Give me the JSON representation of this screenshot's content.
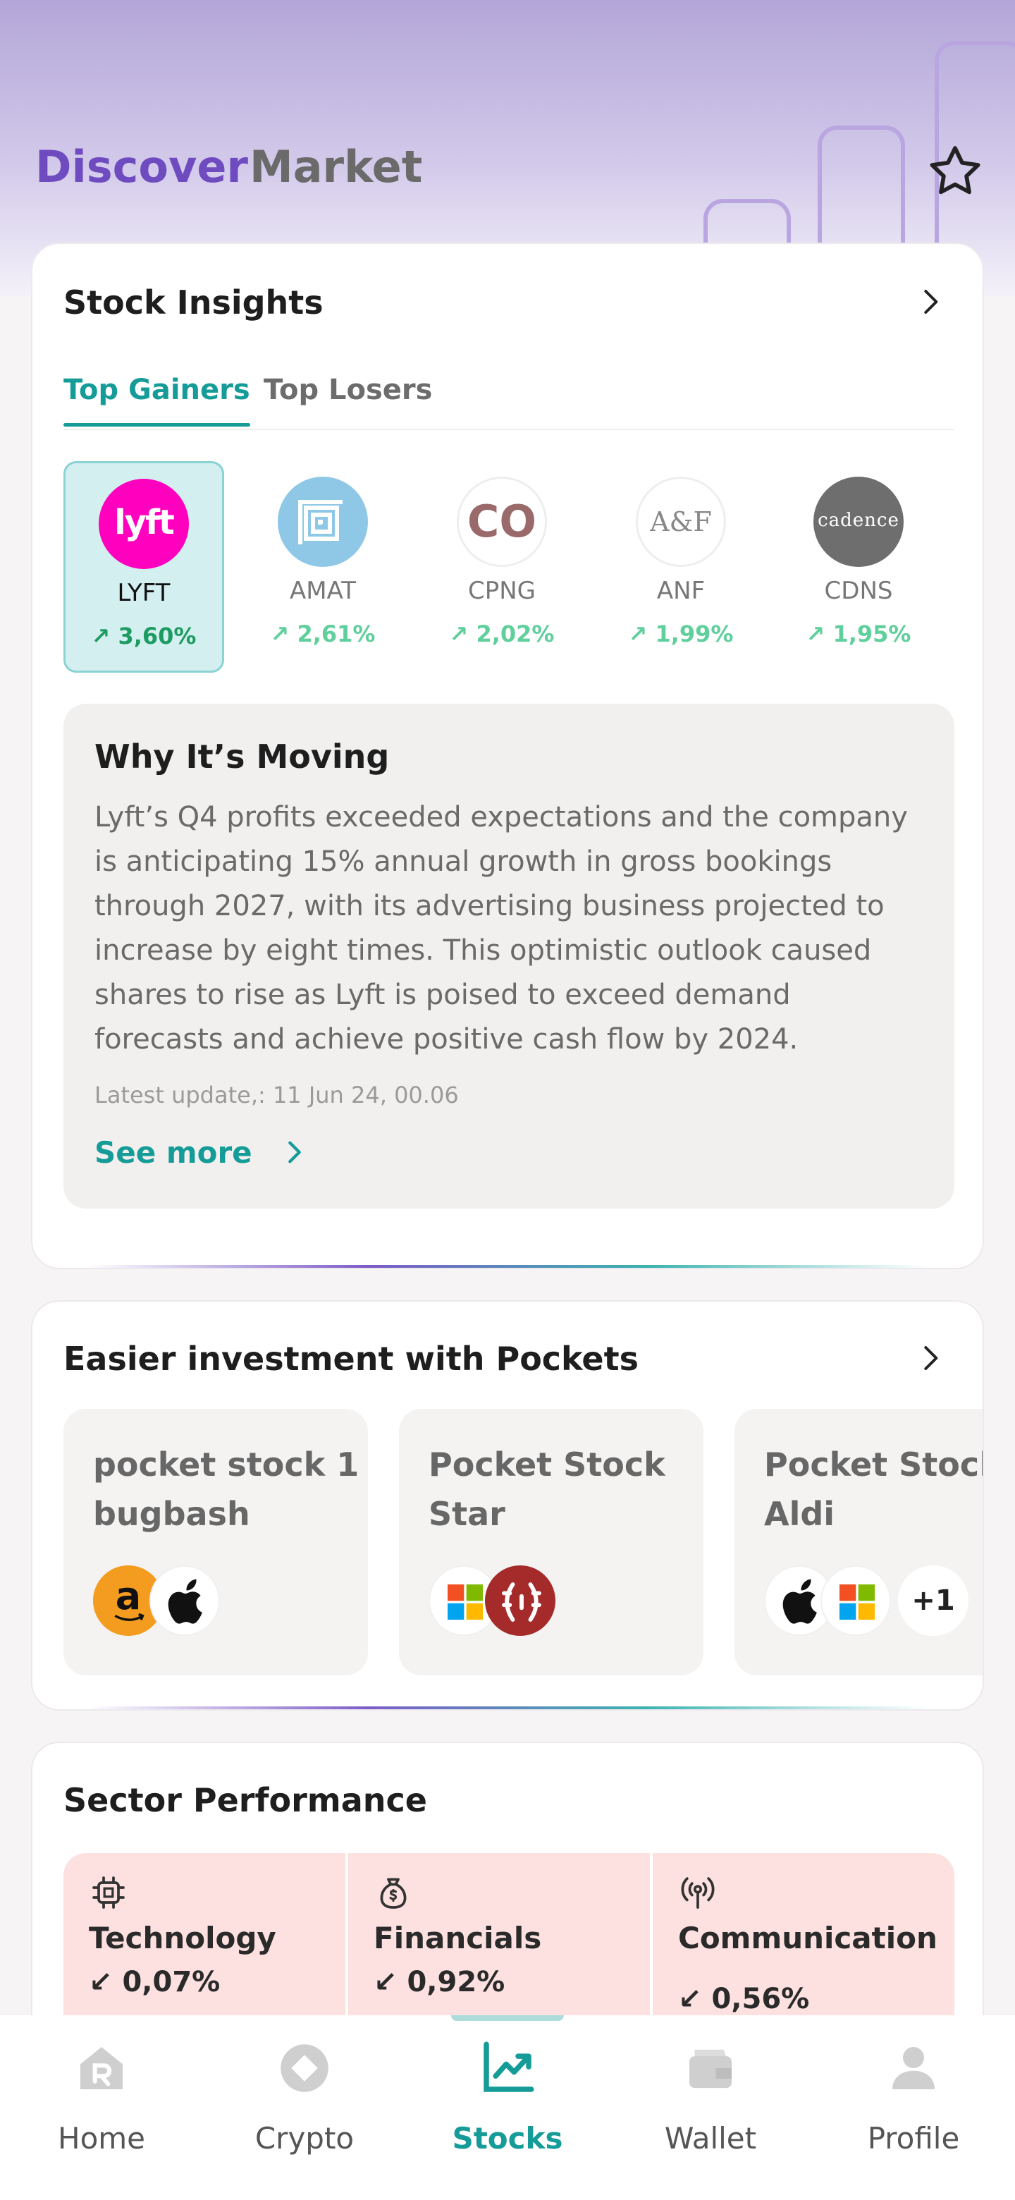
{
  "header": {
    "tabs": [
      {
        "label": "Discover",
        "active": true
      },
      {
        "label": "Market",
        "active": false
      }
    ],
    "favorites_icon": "star-outline-icon"
  },
  "insights": {
    "title": "Stock Insights",
    "tabs": [
      {
        "label": "Top Gainers",
        "active": true
      },
      {
        "label": "Top Losers",
        "active": false
      }
    ],
    "stocks": [
      {
        "ticker": "LYFT",
        "change": "3,60%",
        "logo_text": "lyft",
        "selected": true
      },
      {
        "ticker": "AMAT",
        "change": "2,61%",
        "logo_text": ""
      },
      {
        "ticker": "CPNG",
        "change": "2,02%",
        "logo_text": "CO"
      },
      {
        "ticker": "ANF",
        "change": "1,99%",
        "logo_text": "A&F"
      },
      {
        "ticker": "CDNS",
        "change": "1,95%",
        "logo_text": "cadence"
      }
    ],
    "why": {
      "title": "Why It’s Moving",
      "body": "Lyft’s Q4 profits exceeded expectations and the company is anticipating 15% annual growth in gross bookings through 2027, with its advertising business projected to increase by eight times. This optimistic outlook caused shares to rise as Lyft is poised to exceed demand forecasts and achieve positive cash flow by 2024.",
      "updated": "Latest update,: 11 Jun 24, 00.06",
      "see_more": "See more"
    }
  },
  "pockets": {
    "title": "Easier investment with Pockets",
    "items": [
      {
        "line1": "pocket stock 1",
        "line2": "bugbash",
        "logos": [
          "amazon-logo",
          "apple-logo"
        ],
        "extra": ""
      },
      {
        "line1": "Pocket Stock",
        "line2": "Star",
        "logos": [
          "microsoft-logo",
          "laurel-logo"
        ],
        "extra": ""
      },
      {
        "line1": "Pocket Stock",
        "line2": "Aldi",
        "logos": [
          "apple-logo",
          "microsoft-logo"
        ],
        "extra": "+1"
      }
    ]
  },
  "sectors": {
    "title": "Sector Performance",
    "items": [
      {
        "name": "Technology",
        "change": "0,07%",
        "icon": "chip-icon"
      },
      {
        "name": "Financials",
        "change": "0,92%",
        "icon": "money-bag-icon"
      },
      {
        "name": "Communication",
        "change": "0,56%",
        "icon": "broadcast-icon"
      }
    ]
  },
  "nav": {
    "items": [
      {
        "label": "Home",
        "icon": "home-icon"
      },
      {
        "label": "Crypto",
        "icon": "crypto-icon"
      },
      {
        "label": "Stocks",
        "icon": "stocks-chart-icon",
        "active": true
      },
      {
        "label": "Wallet",
        "icon": "wallet-icon"
      },
      {
        "label": "Profile",
        "icon": "profile-icon"
      }
    ]
  },
  "colors": {
    "accent_teal": "#159c98",
    "brand_purple": "#6f4bc0",
    "gain_green": "#1d9c62",
    "sector_bg": "#fde0e0"
  }
}
